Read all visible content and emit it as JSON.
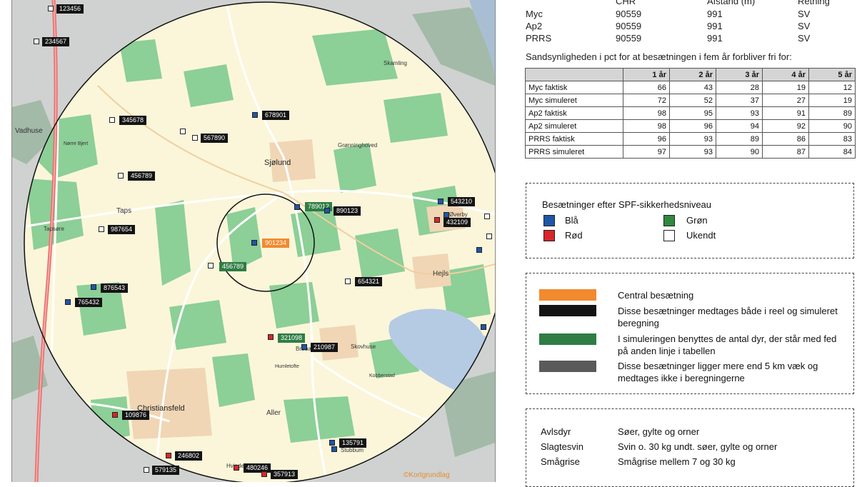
{
  "map": {
    "watermark": "©Kortgrundlag",
    "towns": [
      {
        "name": "Vadhuse"
      },
      {
        "name": "Nørre Bjert"
      },
      {
        "name": "Taps"
      },
      {
        "name": "Tapsøre"
      },
      {
        "name": "Sjølund"
      },
      {
        "name": "Christiansfeld"
      },
      {
        "name": "Aller"
      },
      {
        "name": "Stubbum"
      },
      {
        "name": "Brøbæk"
      },
      {
        "name": "Skovhuse"
      },
      {
        "name": "Hejls"
      },
      {
        "name": "Øverby"
      },
      {
        "name": "Hvinderup"
      },
      {
        "name": "Skamling"
      },
      {
        "name": "Grønninghoved"
      },
      {
        "name": "Kobberstad"
      },
      {
        "name": "Humletofte"
      }
    ],
    "herds": [
      {
        "id": "123456",
        "color": "white",
        "label": "black"
      },
      {
        "id": "234567",
        "color": "white",
        "label": "black"
      },
      {
        "id": "345678",
        "color": "white",
        "label": "black"
      },
      {
        "id": "567890",
        "color": "white",
        "label": "black"
      },
      {
        "id": "678901",
        "color": "blue",
        "label": "black"
      },
      {
        "id": "456789",
        "color": "white",
        "label": "black"
      },
      {
        "id": "987654",
        "color": "white",
        "label": "black"
      },
      {
        "id": "789012",
        "color": "blue",
        "label": "green"
      },
      {
        "id": "890123",
        "color": "blue",
        "label": "black"
      },
      {
        "id": "543210",
        "color": "blue",
        "label": "black"
      },
      {
        "id": "432109",
        "color": "red",
        "label": "black"
      },
      {
        "id": "901234",
        "color": "blue",
        "label": "orange"
      },
      {
        "id": "456789",
        "color": "white",
        "label": "green"
      },
      {
        "id": "654321",
        "color": "white",
        "label": "black"
      },
      {
        "id": "876543",
        "color": "blue",
        "label": "black"
      },
      {
        "id": "765432",
        "color": "blue",
        "label": "black"
      },
      {
        "id": "321098",
        "color": "red",
        "label": "green"
      },
      {
        "id": "210987",
        "color": "blue",
        "label": "black"
      },
      {
        "id": "109876",
        "color": "red",
        "label": "black"
      },
      {
        "id": "135791",
        "color": "blue",
        "label": "black"
      },
      {
        "id": "246802",
        "color": "red",
        "label": "black"
      },
      {
        "id": "480246",
        "color": "red",
        "label": "black"
      },
      {
        "id": "579135",
        "color": "white",
        "label": "black"
      },
      {
        "id": "357913",
        "color": "red",
        "label": "black"
      }
    ]
  },
  "info": {
    "headers": {
      "chr": "CHR",
      "afstand": "Afstand (m)",
      "retning": "Retning"
    },
    "rows": [
      {
        "name": "Myc",
        "chr": "90559",
        "afstand": "991",
        "retning": "SV"
      },
      {
        "name": "Ap2",
        "chr": "90559",
        "afstand": "991",
        "retning": "SV"
      },
      {
        "name": "PRRS",
        "chr": "90559",
        "afstand": "991",
        "retning": "SV"
      }
    ]
  },
  "probability": {
    "title": "Sandsynligheden i pct for at besætningen i fem år forbliver fri for:",
    "columns": [
      "1 år",
      "2 år",
      "3 år",
      "4 år",
      "5 år"
    ],
    "rows": [
      {
        "name": "Myc faktisk",
        "values": [
          "66",
          "43",
          "28",
          "19",
          "12"
        ]
      },
      {
        "name": "Myc simuleret",
        "values": [
          "72",
          "52",
          "37",
          "27",
          "19"
        ]
      },
      {
        "name": "Ap2 faktisk",
        "values": [
          "98",
          "95",
          "93",
          "91",
          "89"
        ]
      },
      {
        "name": "Ap2 simuleret",
        "values": [
          "98",
          "96",
          "94",
          "92",
          "90"
        ]
      },
      {
        "name": "PRRS faktisk",
        "values": [
          "96",
          "93",
          "89",
          "86",
          "83"
        ]
      },
      {
        "name": "PRRS simuleret",
        "values": [
          "97",
          "93",
          "90",
          "87",
          "84"
        ]
      }
    ]
  },
  "legend_spf": {
    "title": "Besætninger efter SPF-sikkerhedsniveau",
    "items": [
      {
        "label": "Blå",
        "color": "#1f56a8"
      },
      {
        "label": "Grøn",
        "color": "#2f8a3f"
      },
      {
        "label": "Rød",
        "color": "#d8262a"
      },
      {
        "label": "Ukendt",
        "color": "#ffffff"
      }
    ]
  },
  "legend_labels": {
    "items": [
      {
        "color": "#f28a2e",
        "text": "Central besætning"
      },
      {
        "color": "#141414",
        "text": "Disse besætninger medtages både i reel og simuleret beregning"
      },
      {
        "color": "#2f7d45",
        "text": "I simuleringen benyttes de antal dyr, der står med fed på anden linje i tabellen"
      },
      {
        "color": "#5a5a5a",
        "text": "Disse besætninger ligger mere end 5 km væk og medtages ikke i beregningerne"
      }
    ]
  },
  "definitions": {
    "items": [
      {
        "term": "Avlsdyr",
        "desc": "Søer, gylte og orner"
      },
      {
        "term": "Slagtesvin",
        "desc": "Svin o. 30 kg undt. søer, gylte og orner"
      },
      {
        "term": "Smågrise",
        "desc": "Smågrise mellem 7 og 30 kg"
      }
    ]
  }
}
